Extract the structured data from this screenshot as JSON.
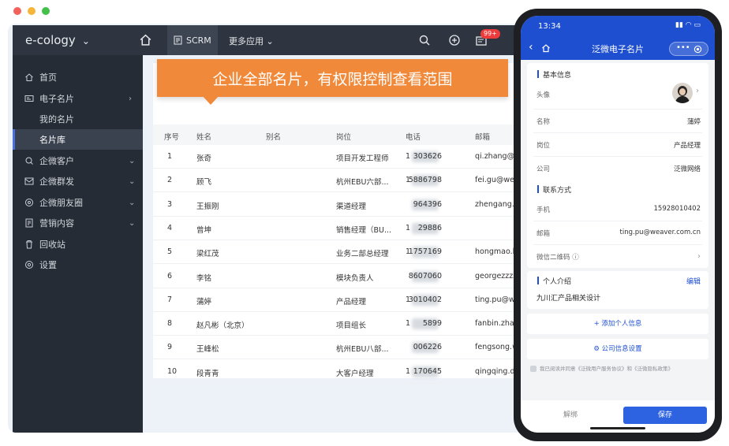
{
  "app": {
    "logo": "e-cology",
    "nav_active": "SCRM",
    "nav_more": "更多应用",
    "notification_badge": "99+"
  },
  "sidebar": {
    "items": [
      {
        "label": "首页",
        "icon": "home-icon"
      },
      {
        "label": "电子名片",
        "icon": "card-icon",
        "arrow": "›"
      },
      {
        "label": "我的名片"
      },
      {
        "label": "名片库",
        "active": true
      },
      {
        "label": "企微客户",
        "icon": "customer-icon",
        "arrow": "⌄"
      },
      {
        "label": "企微群发",
        "icon": "broadcast-icon",
        "arrow": "⌄"
      },
      {
        "label": "企微朋友圈",
        "icon": "moments-icon",
        "arrow": "⌄"
      },
      {
        "label": "营销内容",
        "icon": "document-icon",
        "arrow": "⌄"
      },
      {
        "label": "回收站",
        "icon": "trash-icon"
      },
      {
        "label": "设置",
        "icon": "gear-icon"
      }
    ]
  },
  "banner": "企业全部名片，有权限控制查看范围",
  "table": {
    "headers": [
      "序号",
      "姓名",
      "别名",
      "岗位",
      "电话",
      "邮箱"
    ],
    "rows": [
      [
        "1",
        "张奇",
        "",
        "项目开发工程师",
        "1",
        "303626",
        "qi.zhang@w"
      ],
      [
        "2",
        "顾飞",
        "",
        "杭州EBU六部...",
        "1",
        "5886798",
        "fei.gu@weav"
      ],
      [
        "3",
        "王振刚",
        "",
        "渠道经理",
        "",
        "964396",
        "zhengang.w"
      ],
      [
        "4",
        "曾坤",
        "",
        "销售经理（BU...",
        "1",
        "29886",
        ""
      ],
      [
        "5",
        "梁红茂",
        "",
        "业务二部总经理",
        "1",
        "1757169",
        "hongmao.lia"
      ],
      [
        "6",
        "李铭",
        "",
        "模块负责人",
        "",
        "8607060",
        "georgezzzz("
      ],
      [
        "7",
        "蒲婷",
        "",
        "产品经理",
        "1",
        "3010402",
        "ting.pu@we"
      ],
      [
        "8",
        "赵凡彬（北京）",
        "",
        "项目组长",
        "1",
        "5899",
        "fanbin.zhao("
      ],
      [
        "9",
        "王峰松",
        "",
        "杭州EBU八部...",
        "",
        "006226",
        "fengsong.wa"
      ],
      [
        "10",
        "段青青",
        "",
        "大客户经理",
        "1",
        "170645",
        "qingqing.dua"
      ]
    ]
  },
  "phone": {
    "time": "13:34",
    "title": "泛微电子名片",
    "basic": {
      "section": "基本信息",
      "avatar_label": "头像",
      "name_label": "名称",
      "name": "蒲婷",
      "position_label": "岗位",
      "position": "产品经理",
      "company_label": "公司",
      "company": "泛微网络"
    },
    "contact": {
      "section": "联系方式",
      "mobile_label": "手机",
      "mobile": "15928010402",
      "email_label": "邮箱",
      "email": "ting.pu@weaver.com.cn",
      "wechat_label": "微信二维码"
    },
    "intro": {
      "section": "个人介绍",
      "edit": "编辑",
      "text": "九川汇产品相关设计"
    },
    "add_info": "+ 添加个人信息",
    "company_settings": "公司信息设置",
    "agreement": "我已阅读并同意《泛微用户服务协议》和《泛微隐私政策》",
    "unbind": "解绑",
    "save": "保存"
  }
}
